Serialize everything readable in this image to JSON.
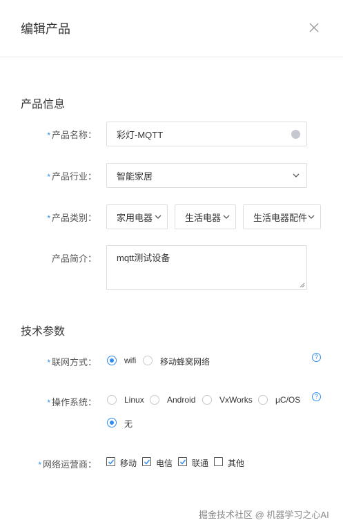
{
  "dialog": {
    "title": "编辑产品",
    "close_icon": "close-icon"
  },
  "sections": {
    "product_info": "产品信息",
    "tech_params": "技术参数"
  },
  "form": {
    "name": {
      "label": "产品名称：",
      "value": "彩灯-MQTT",
      "required": true
    },
    "industry": {
      "label": "产品行业：",
      "value": "智能家居",
      "required": true
    },
    "category": {
      "label": "产品类别：",
      "required": true,
      "level1": "家用电器",
      "level2": "生活电器",
      "level3": "生活电器配件"
    },
    "description": {
      "label": "产品简介：",
      "value": "mqtt测试设备",
      "required": false
    }
  },
  "tech": {
    "network": {
      "label": "联网方式：",
      "required": true,
      "options": [
        "wifi",
        "移动蜂窝网络"
      ],
      "selected": "wifi"
    },
    "os": {
      "label": "操作系统：",
      "required": true,
      "options": [
        "Linux",
        "Android",
        "VxWorks",
        "μC/OS",
        "无"
      ],
      "selected": "无"
    },
    "carrier": {
      "label": "网络运营商：",
      "required": true,
      "options": [
        {
          "label": "移动",
          "checked": true
        },
        {
          "label": "电信",
          "checked": true
        },
        {
          "label": "联通",
          "checked": true
        },
        {
          "label": "其他",
          "checked": false
        }
      ]
    }
  },
  "required_mark": "*",
  "help_mark": "?",
  "watermark": "掘金技术社区 @ 机器学习之心AI",
  "colors": {
    "accent": "#2d8cf0",
    "border": "#dcdee2"
  }
}
